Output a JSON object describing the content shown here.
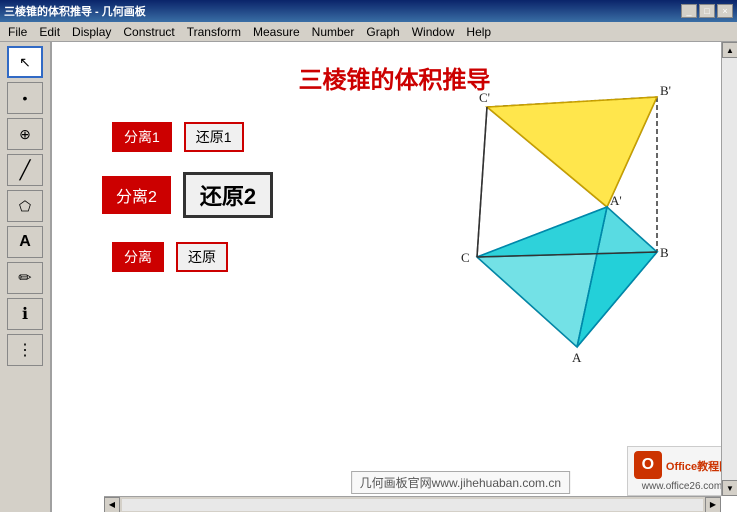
{
  "titlebar": {
    "title": "三棱锥的体积推导 - 几何画板"
  },
  "menubar": {
    "items": [
      "File",
      "Edit",
      "Display",
      "Construct",
      "Transform",
      "Measure",
      "Number",
      "Graph",
      "Window",
      "Help"
    ]
  },
  "toolbar": {
    "tools": [
      {
        "name": "arrow",
        "icon": "↖"
      },
      {
        "name": "point",
        "icon": "•"
      },
      {
        "name": "compass",
        "icon": "⊕"
      },
      {
        "name": "line",
        "icon": "/"
      },
      {
        "name": "polygon",
        "icon": "⬟"
      },
      {
        "name": "text",
        "icon": "A"
      },
      {
        "name": "marker",
        "icon": "✏"
      },
      {
        "name": "info",
        "icon": "ℹ"
      },
      {
        "name": "more",
        "icon": "⋮"
      }
    ]
  },
  "content": {
    "title": "三棱锥的体积推导",
    "buttons": {
      "separate1_label": "分离1",
      "restore1_label": "还原1",
      "separate2_label": "分离2",
      "restore2_label": "还原2",
      "separate3_label": "分离",
      "restore3_label": "还原"
    },
    "watermark": "几何画板官网www.jihehuaban.com.cn"
  },
  "office": {
    "name": "Office教程网",
    "url": "www.office26.com"
  },
  "geometry": {
    "labels": {
      "c_prime": "C'",
      "b_prime": "B'",
      "a_prime": "A'",
      "c": "C",
      "b": "B",
      "a": "A"
    }
  }
}
